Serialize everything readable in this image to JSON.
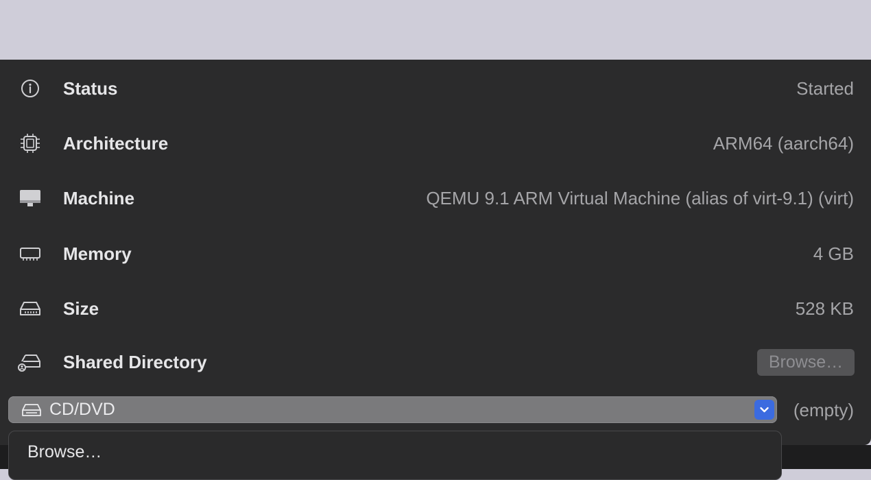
{
  "rows": [
    {
      "label": "Status",
      "value": "Started",
      "icon": "info-icon"
    },
    {
      "label": "Architecture",
      "value": "ARM64 (aarch64)",
      "icon": "cpu-icon"
    },
    {
      "label": "Machine",
      "value": "QEMU 9.1 ARM Virtual Machine (alias of virt-9.1) (virt)",
      "icon": "monitor-icon"
    },
    {
      "label": "Memory",
      "value": "4 GB",
      "icon": "memory-icon"
    },
    {
      "label": "Size",
      "value": "528 KB",
      "icon": "drive-icon"
    },
    {
      "label": "Shared Directory",
      "button": "Browse…",
      "icon": "shared-drive-icon"
    }
  ],
  "cd_dvd": {
    "label": "CD/DVD",
    "value": "(empty)",
    "icon": "disc-drive-icon"
  },
  "menu": {
    "items": [
      "Browse…"
    ]
  },
  "colors": {
    "panel": "#2b2b2c",
    "accent": "#3b6be0",
    "top_band": "#cfcdd9"
  }
}
